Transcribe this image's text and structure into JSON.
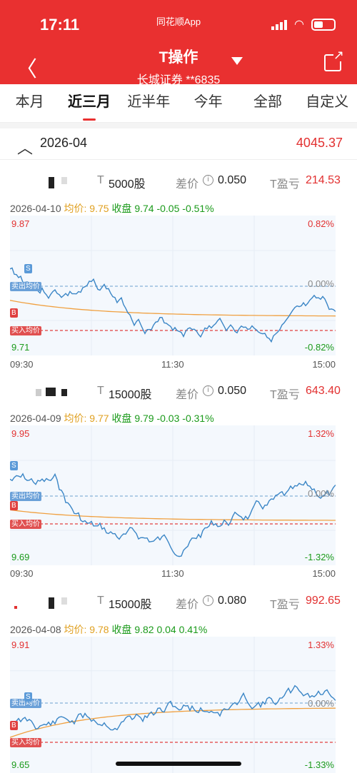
{
  "status": {
    "time": "17:11",
    "app": "同花顺App"
  },
  "header": {
    "title": "T操作",
    "account": "长城证券 **6835"
  },
  "tabs": [
    "本月",
    "近三月",
    "近半年",
    "今年",
    "全部",
    "自定义"
  ],
  "month": {
    "label": "2026-04",
    "amount": "4045.37"
  },
  "labels": {
    "t": "T",
    "diff": "差价",
    "tprofit": "T盈亏",
    "avg": "均价:",
    "close": "收盘",
    "sell_avg": "卖出均价",
    "buy_avg": "买入均价",
    "s": "S",
    "b": "B"
  },
  "days": [
    {
      "qty": "5000股",
      "diff": "0.050",
      "profit": "214.53",
      "date": "2026-04-10",
      "avg": "9.75",
      "close": "9.74",
      "chg": "-0.05",
      "pct": "-0.51%",
      "high": "9.87",
      "low": "9.71",
      "high_pct": "0.82%",
      "mid_pct": "0.00%",
      "low_pct": "-0.82%",
      "times": [
        "09:30",
        "11:30",
        "15:00"
      ]
    },
    {
      "qty": "15000股",
      "diff": "0.050",
      "profit": "643.40",
      "date": "2026-04-09",
      "avg": "9.77",
      "close": "9.79",
      "chg": "-0.03",
      "pct": "-0.31%",
      "high": "9.95",
      "low": "9.69",
      "high_pct": "1.32%",
      "mid_pct": "0.00%",
      "low_pct": "-1.32%",
      "times": [
        "09:30",
        "11:30",
        "15:00"
      ]
    },
    {
      "qty": "15000股",
      "diff": "0.080",
      "profit": "992.65",
      "date": "2026-04-08",
      "avg": "9.78",
      "close": "9.82",
      "chg": "0.04",
      "pct": "0.41%",
      "high": "9.91",
      "low": "9.65",
      "high_pct": "1.33%",
      "mid_pct": "0.00%",
      "low_pct": "-1.33%",
      "times": []
    }
  ]
}
